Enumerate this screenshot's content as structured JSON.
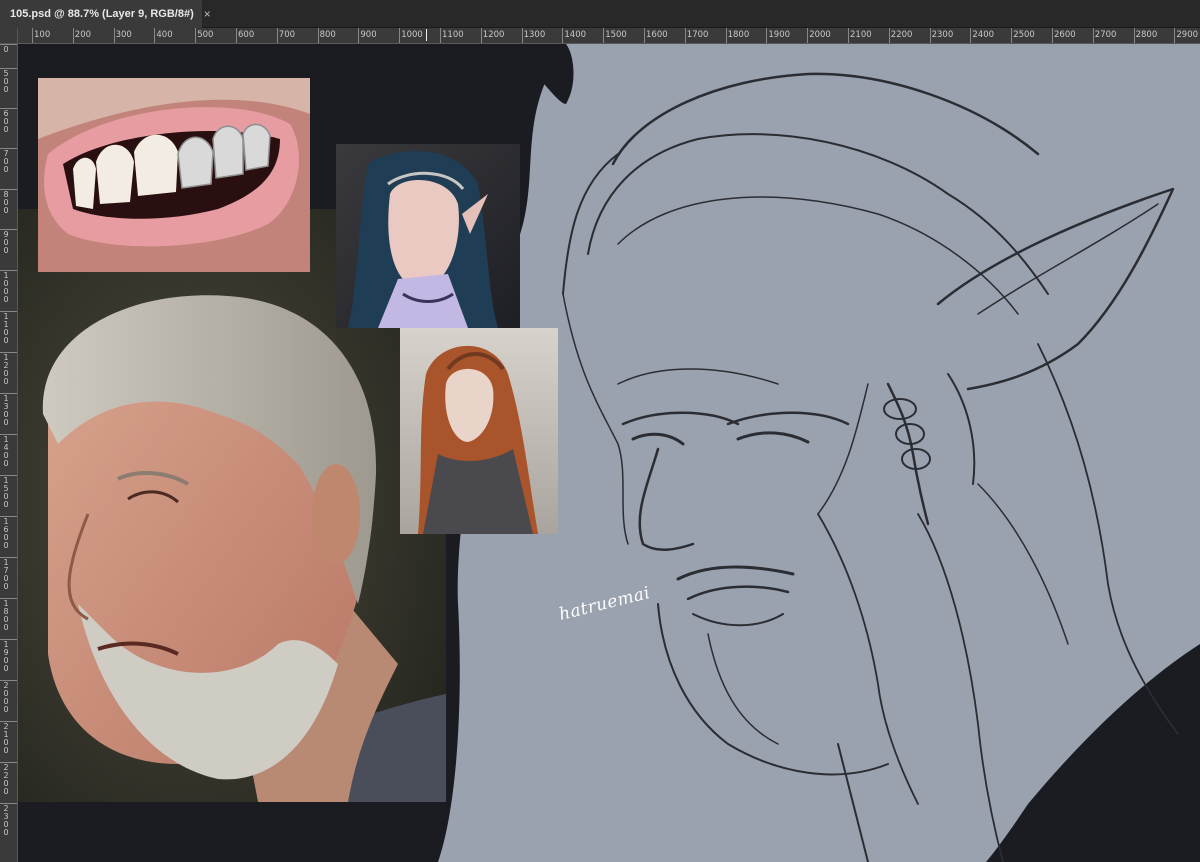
{
  "tab": {
    "title": "105.psd @ 88.7% (Layer 9, RGB/8#)",
    "close": "×"
  },
  "ruler": {
    "top": [
      "100",
      "200",
      "300",
      "400",
      "500",
      "600",
      "700",
      "800",
      "900",
      "1000",
      "1100",
      "1200",
      "1300",
      "1400",
      "1500",
      "1600",
      "1700",
      "1800",
      "1900",
      "2000",
      "2100",
      "2200",
      "2300",
      "2400",
      "2500",
      "2600",
      "2700",
      "2800",
      "2900"
    ],
    "left": [
      "0",
      "500",
      "600",
      "700",
      "800",
      "900",
      "1000",
      "1100",
      "1200",
      "1300",
      "1400",
      "1500",
      "1600",
      "1700",
      "1800",
      "1900",
      "2000",
      "2100",
      "2200",
      "2300"
    ]
  },
  "canvas": {
    "signature": "hatruemai",
    "colors": {
      "sketch_bg": "#9aa1af",
      "dark_bg": "#1b1c22",
      "line": "#2b2d33"
    }
  }
}
